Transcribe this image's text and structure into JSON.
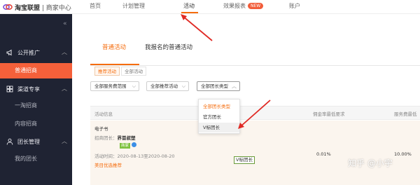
{
  "topnav": {
    "logo_brand": "淘宝联盟",
    "logo_sub": "商家中心",
    "items": [
      {
        "label": "首页"
      },
      {
        "label": "计划管理"
      },
      {
        "label": "活动"
      },
      {
        "label": "效果报表",
        "badge": "NEW"
      },
      {
        "label": "账户"
      }
    ]
  },
  "sidebar": {
    "collapse_icon": "double-chevron-left-icon",
    "groups": [
      {
        "label": "公开推广",
        "icon": "megaphone-icon",
        "expanded": true
      },
      {
        "label": "渠道专享",
        "icon": "grid-icon",
        "expanded": true
      },
      {
        "label": "团长管理",
        "icon": "user-icon",
        "expanded": true
      }
    ],
    "items": [
      {
        "label": "普通招商",
        "active": true
      },
      {
        "label": "一淘招商"
      },
      {
        "label": "内容招商"
      },
      {
        "label": "我的团长"
      }
    ]
  },
  "main": {
    "tabs": [
      {
        "label": "普通活动",
        "active": true
      },
      {
        "label": "我报名的普通活动"
      }
    ],
    "pills": [
      {
        "label": "推荐活动",
        "active": true
      },
      {
        "label": "全部活动"
      }
    ],
    "filters": [
      {
        "label": "全部服务费范围"
      },
      {
        "label": "全部推荐活动"
      },
      {
        "label": "全部团长类型"
      }
    ],
    "dropdown_options": [
      {
        "label": "全部团长类型",
        "selected": true
      },
      {
        "label": "官方团长"
      },
      {
        "label": "V标团长",
        "hover": true
      }
    ],
    "table_headers": [
      "活动信息",
      "佣金率最低要求",
      "服务费最低"
    ],
    "row": {
      "category": "电子书",
      "leader_prefix": "招商团长：",
      "leader_name": "界首叔塑",
      "tag_green": "商家",
      "v_tag": "V标团长",
      "time": "活动时间：2020-08-13至2020-08-20",
      "promo": "美目优选推荐",
      "commission": "0.01%",
      "service_fee": "10.00%"
    }
  },
  "watermark": "知乎 @小宇",
  "colors": {
    "accent": "#f56d0e",
    "sidebar_bg": "#1f2333",
    "sidebar_active": "#f5603a",
    "arrow": "#e02a24"
  }
}
